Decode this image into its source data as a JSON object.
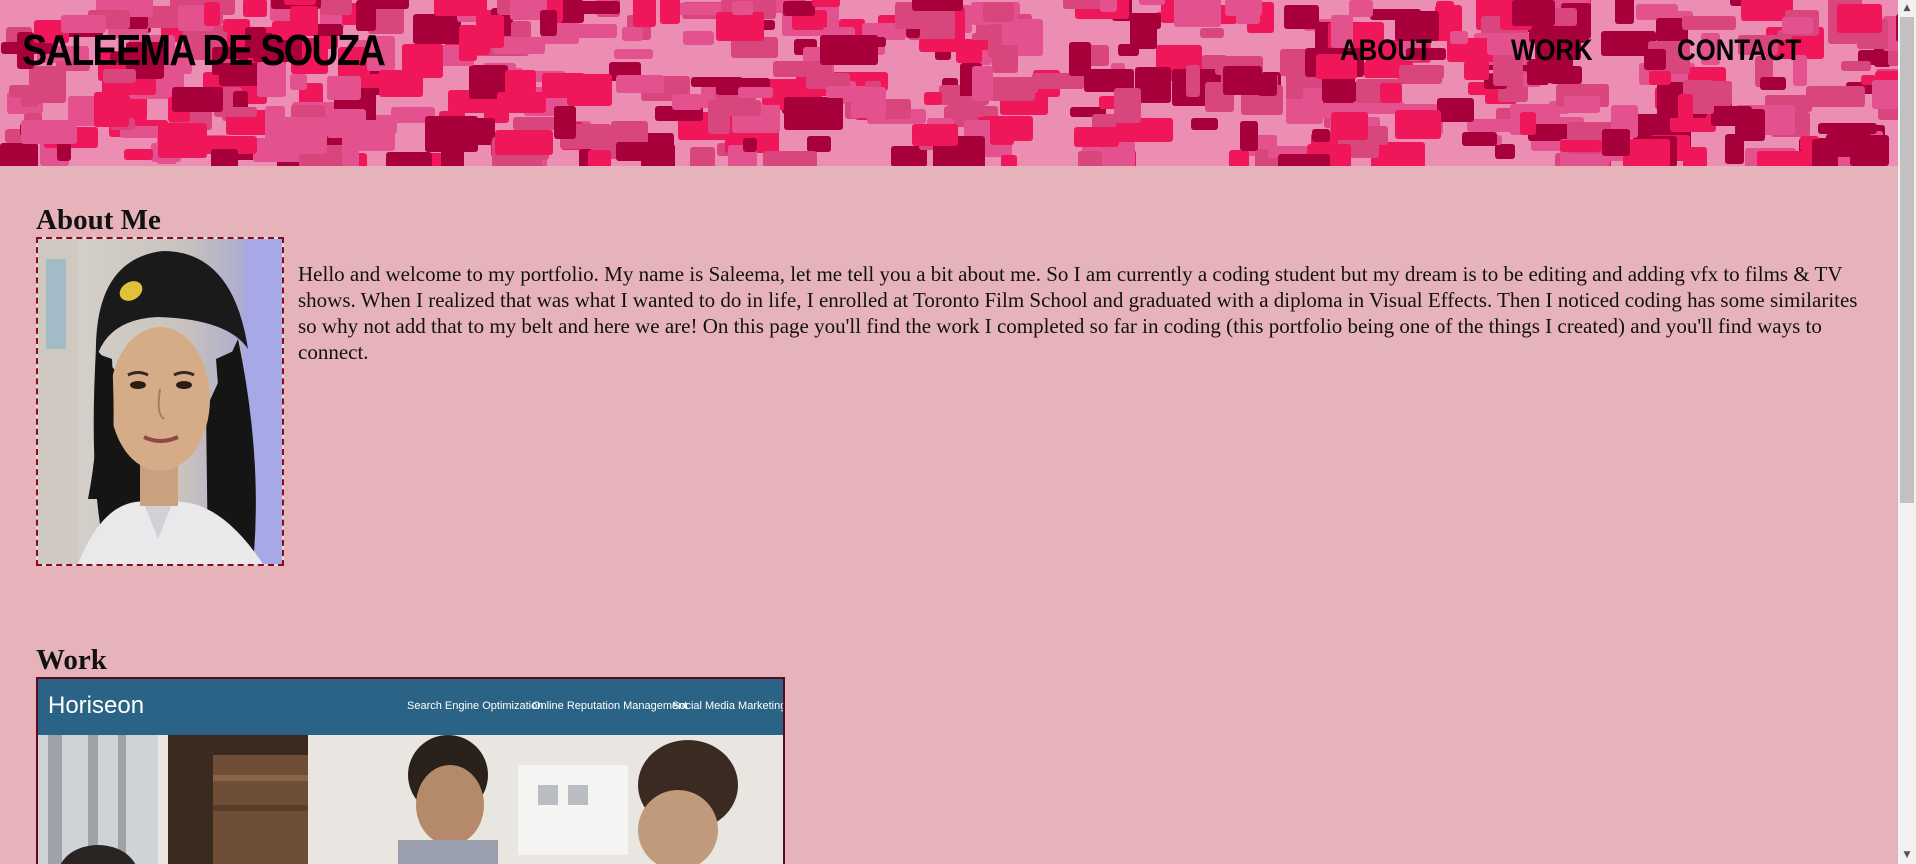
{
  "header": {
    "site_title": "SALEEMA DE SOUZA",
    "nav": {
      "about": "ABOUT",
      "work": "WORK",
      "contact": "CONTACT"
    },
    "pattern_colors": [
      "#ec8db4",
      "#e3528f",
      "#f0165a",
      "#a8003a",
      "#d8467d"
    ]
  },
  "about": {
    "heading": "About Me",
    "text": "Hello and welcome to my portfolio. My name is Saleema, let me tell you a bit about me. So I am currently a coding student but my dream is to be editing and adding vfx to films & TV shows. When I realized that was what I wanted to do in life, I enrolled at Toronto Film School and graduated with a diploma in Visual Effects. Then I noticed coding has some similarites so why not add that to my belt and here we are! On this page you'll find the work I completed so far in coding (this portfolio being one of the things I created) and you'll find ways to connect."
  },
  "work": {
    "heading": "Work",
    "project": {
      "brand": "Horiseon",
      "links": [
        "Search Engine Optimization",
        "Online Reputation Management",
        "Social Media Marketing"
      ]
    }
  },
  "colors": {
    "page_background": "#e6b3bb",
    "image_border": "#8b0a1f",
    "project_header": "#2b6386"
  }
}
